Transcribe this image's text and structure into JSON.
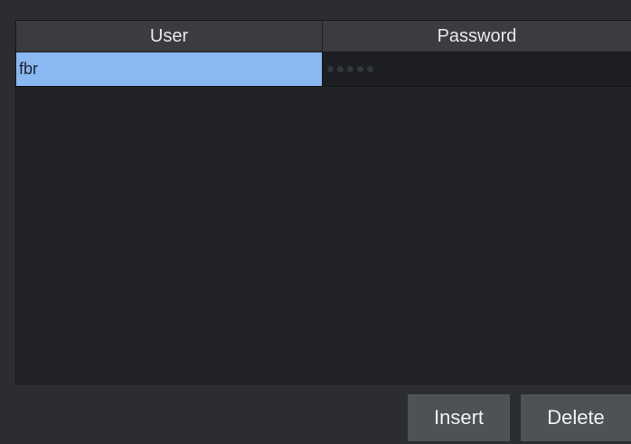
{
  "table": {
    "columns": [
      "User",
      "Password"
    ],
    "rows": [
      {
        "user": "fbr",
        "password_mask_length": 5,
        "selected": true
      }
    ]
  },
  "buttons": {
    "insert_label": "Insert",
    "delete_label": "Delete"
  },
  "colors": {
    "background": "#2b2d31",
    "table_background": "#212327",
    "header_background": "#3a3c40",
    "selection": "#8ab8f0",
    "button_background": "#4e5257"
  }
}
